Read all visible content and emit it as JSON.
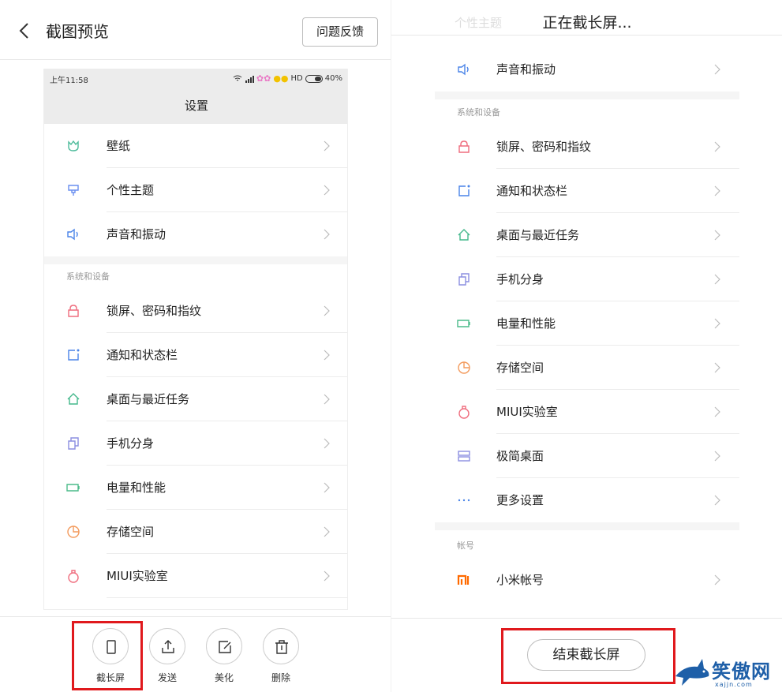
{
  "left": {
    "title": "截图预览",
    "feedback_label": "问题反馈",
    "status": {
      "time": "上午11:58",
      "right": "HD",
      "battery": "40%"
    },
    "settings_title": "设置",
    "items_top": [
      {
        "label": "壁纸",
        "icon": "tulip-icon",
        "color": "#4dbb9b"
      },
      {
        "label": "个性主题",
        "icon": "brush-icon",
        "color": "#6a8ff0"
      },
      {
        "label": "声音和振动",
        "icon": "speaker-icon",
        "color": "#4a84e8"
      }
    ],
    "section": "系统和设备",
    "items_sys": [
      {
        "label": "锁屏、密码和指纹",
        "icon": "lock-icon",
        "color": "#ef6d7e"
      },
      {
        "label": "通知和状态栏",
        "icon": "notification-icon",
        "color": "#4a84e8"
      },
      {
        "label": "桌面与最近任务",
        "icon": "home-icon",
        "color": "#44b88c"
      },
      {
        "label": "手机分身",
        "icon": "second-space-icon",
        "color": "#8c8fe0"
      },
      {
        "label": "电量和性能",
        "icon": "battery-icon",
        "color": "#4cbb8a"
      },
      {
        "label": "存储空间",
        "icon": "storage-icon",
        "color": "#f39a5c"
      },
      {
        "label": "MIUI实验室",
        "icon": "flask-icon",
        "color": "#ef6d7e"
      }
    ],
    "toolbar": [
      {
        "label": "截长屏",
        "icon": "long-screenshot-icon"
      },
      {
        "label": "发送",
        "icon": "share-icon"
      },
      {
        "label": "美化",
        "icon": "edit-icon"
      },
      {
        "label": "删除",
        "icon": "trash-icon"
      }
    ]
  },
  "right": {
    "title": "正在截长屏...",
    "ghost_label": "个性主题",
    "items_top": [
      {
        "label": "声音和振动",
        "icon": "speaker-icon",
        "color": "#4a84e8"
      }
    ],
    "section_sys": "系统和设备",
    "items_sys": [
      {
        "label": "锁屏、密码和指纹",
        "icon": "lock-icon",
        "color": "#ef6d7e"
      },
      {
        "label": "通知和状态栏",
        "icon": "notification-icon",
        "color": "#4a84e8"
      },
      {
        "label": "桌面与最近任务",
        "icon": "home-icon",
        "color": "#44b88c"
      },
      {
        "label": "手机分身",
        "icon": "second-space-icon",
        "color": "#8c8fe0"
      },
      {
        "label": "电量和性能",
        "icon": "battery-icon",
        "color": "#4cbb8a"
      },
      {
        "label": "存储空间",
        "icon": "storage-icon",
        "color": "#f39a5c"
      },
      {
        "label": "MIUI实验室",
        "icon": "flask-icon",
        "color": "#ef6d7e"
      },
      {
        "label": "极简桌面",
        "icon": "simple-home-icon",
        "color": "#8c8fe0"
      },
      {
        "label": "更多设置",
        "icon": "more-icon",
        "color": "#4a84e8"
      }
    ],
    "section_account": "帐号",
    "items_account": [
      {
        "label": "小米帐号",
        "icon": "mi-icon",
        "color": "#ff6a00"
      }
    ],
    "end_label": "结束截长屏"
  },
  "watermark": {
    "text": "笑傲网",
    "sub": "xajjn.com"
  }
}
